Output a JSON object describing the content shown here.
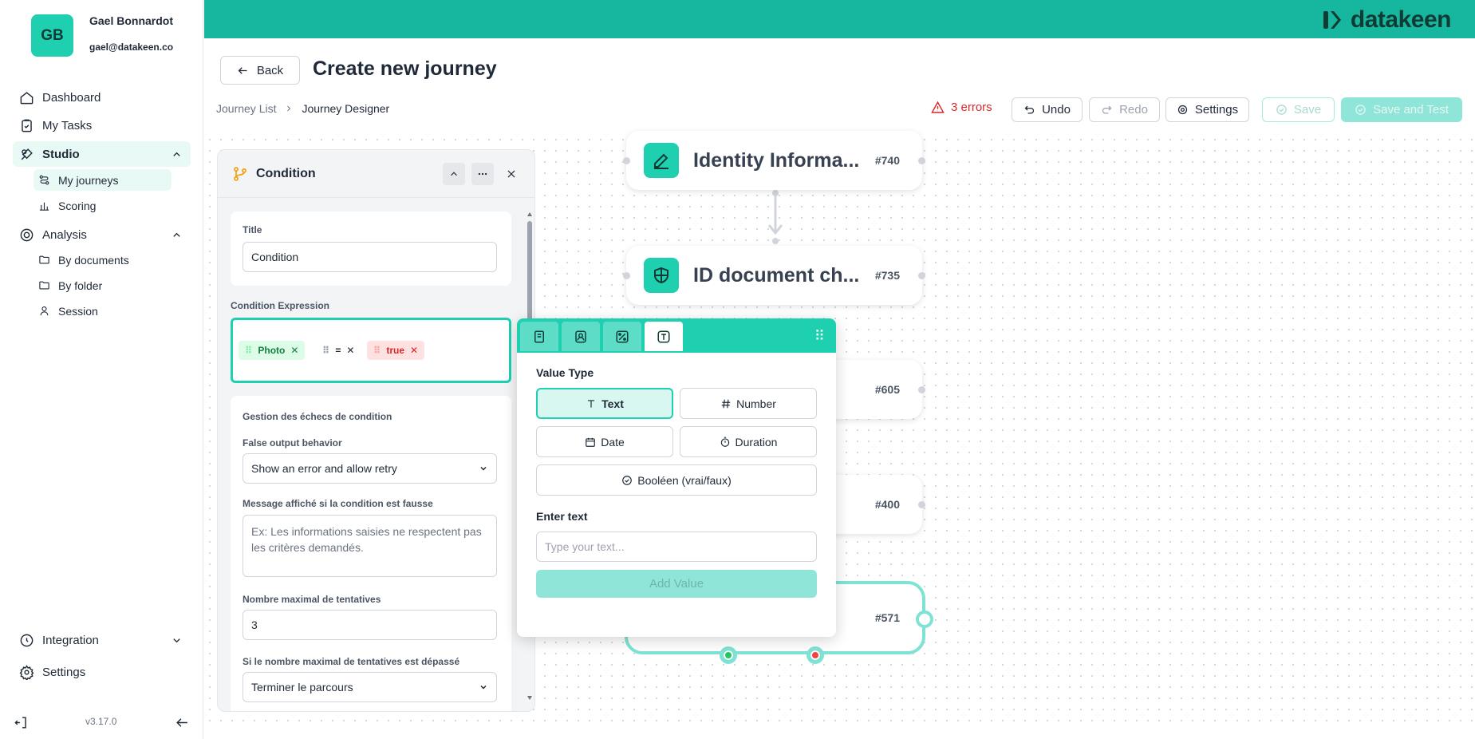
{
  "user": {
    "initials": "GB",
    "name": "Gael Bonnardot",
    "email": "gael@datakeen.co"
  },
  "nav": {
    "dashboard": "Dashboard",
    "my_tasks": "My Tasks",
    "studio": "Studio",
    "my_journeys": "My journeys",
    "scoring": "Scoring",
    "analysis": "Analysis",
    "by_documents": "By documents",
    "by_folder": "By folder",
    "session": "Session",
    "integration": "Integration",
    "settings": "Settings"
  },
  "version": "v3.17.0",
  "brand": {
    "name": "datakeen",
    "color": "#17b79f"
  },
  "header": {
    "back_label": "Back",
    "title": "Create new journey"
  },
  "breadcrumb": {
    "list": "Journey List",
    "current": "Journey Designer"
  },
  "toolbar": {
    "errors": "3 errors",
    "undo": "Undo",
    "redo": "Redo",
    "settings": "Settings",
    "save": "Save",
    "save_test": "Save and Test"
  },
  "nodes": [
    {
      "title": "Identity Informa...",
      "num": "#740"
    },
    {
      "title": "ID document ch...",
      "num": "#735"
    },
    {
      "title": "",
      "num": "#605"
    },
    {
      "title": "",
      "num": "#400"
    },
    {
      "title": "",
      "num": "#571"
    }
  ],
  "panel": {
    "title": "Condition",
    "title_label": "Title",
    "title_value": "Condition",
    "expr_label": "Condition Expression",
    "tags": {
      "field": "Photo",
      "op": "=",
      "value": "true"
    },
    "failure_heading": "Gestion des échecs de condition",
    "false_output_label": "False output behavior",
    "false_output_value": "Show an error and allow retry",
    "message_label": "Message affiché si la condition est fausse",
    "message_placeholder": "Ex: Les informations saisies ne respectent pas les critères demandés.",
    "max_attempts_label": "Nombre maximal de tentatives",
    "max_attempts_value": "3",
    "exceeded_label": "Si le nombre maximal de tentatives est dépassé",
    "exceeded_value": "Terminer le parcours"
  },
  "popup": {
    "value_type_label": "Value Type",
    "types": {
      "text": "Text",
      "number": "Number",
      "date": "Date",
      "duration": "Duration",
      "boolean": "Booléen (vrai/faux)"
    },
    "enter_text_label": "Enter text",
    "text_placeholder": "Type your text...",
    "add_value": "Add Value"
  }
}
